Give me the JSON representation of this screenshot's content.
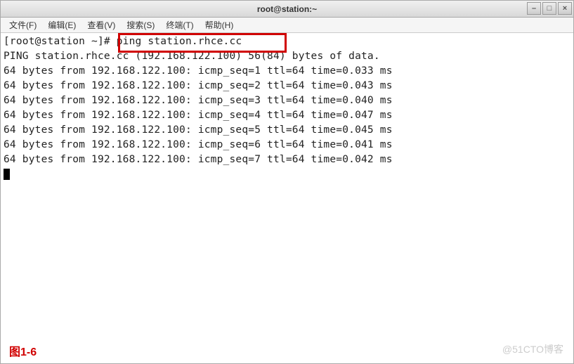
{
  "window": {
    "title": "root@station:~"
  },
  "menubar": {
    "items": [
      {
        "label": "文件(F)"
      },
      {
        "label": "编辑(E)"
      },
      {
        "label": "查看(V)"
      },
      {
        "label": "搜索(S)"
      },
      {
        "label": "终端(T)"
      },
      {
        "label": "帮助(H)"
      }
    ]
  },
  "terminal": {
    "prompt": "[root@station ~]# ",
    "command": "ping station.rhce.cc",
    "header": "PING station.rhce.cc (192.168.122.100) 56(84) bytes of data.",
    "lines": [
      "64 bytes from 192.168.122.100: icmp_seq=1 ttl=64 time=0.033 ms",
      "64 bytes from 192.168.122.100: icmp_seq=2 ttl=64 time=0.043 ms",
      "64 bytes from 192.168.122.100: icmp_seq=3 ttl=64 time=0.040 ms",
      "64 bytes from 192.168.122.100: icmp_seq=4 ttl=64 time=0.047 ms",
      "64 bytes from 192.168.122.100: icmp_seq=5 ttl=64 time=0.045 ms",
      "64 bytes from 192.168.122.100: icmp_seq=6 ttl=64 time=0.041 ms",
      "64 bytes from 192.168.122.100: icmp_seq=7 ttl=64 time=0.042 ms"
    ]
  },
  "annotations": {
    "figure_label": "图1-6",
    "watermark": "@51CTO博客"
  }
}
